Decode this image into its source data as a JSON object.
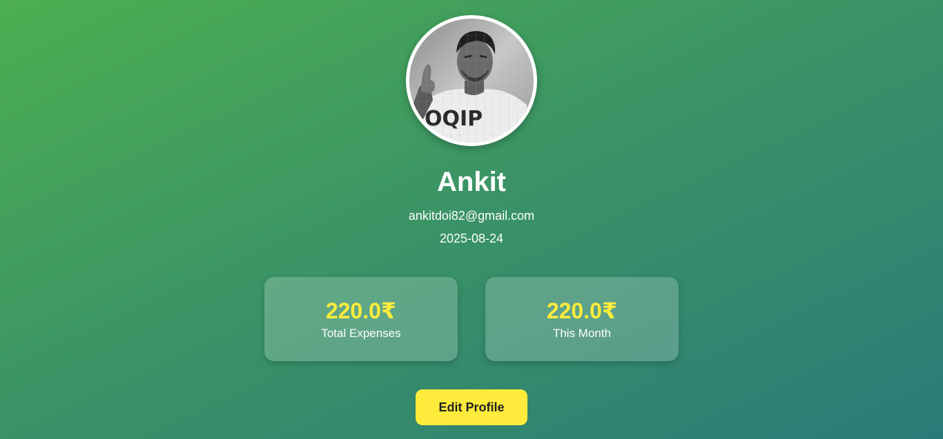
{
  "profile": {
    "name": "Ankit",
    "email": "ankitdoi82@gmail.com",
    "joined": "2025-08-24"
  },
  "stats": {
    "total": {
      "value": "220.0₹",
      "label": "Total Expenses"
    },
    "month": {
      "value": "220.0₹",
      "label": "This Month"
    }
  },
  "actions": {
    "edit_label": "Edit Profile"
  },
  "colors": {
    "gradient_start": "#4caf50",
    "gradient_end": "#2b7a78",
    "accent": "#ffeb3b",
    "text": "#ffffff"
  }
}
